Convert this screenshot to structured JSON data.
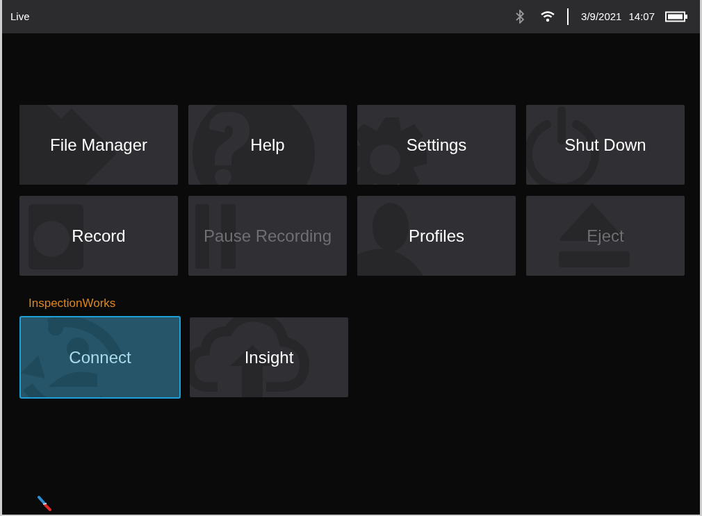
{
  "status_bar": {
    "mode": "Live",
    "date": "3/9/2021",
    "time": "14:07"
  },
  "tiles": [
    {
      "label": "File Manager",
      "kind": "folder",
      "disabled": false,
      "selected": false
    },
    {
      "label": "Help",
      "kind": "help",
      "disabled": false,
      "selected": false
    },
    {
      "label": "Settings",
      "kind": "gear",
      "disabled": false,
      "selected": false
    },
    {
      "label": "Shut Down",
      "kind": "power",
      "disabled": false,
      "selected": false
    },
    {
      "label": "Record",
      "kind": "record",
      "disabled": false,
      "selected": false
    },
    {
      "label": "Pause Recording",
      "kind": "pause",
      "disabled": true,
      "selected": false
    },
    {
      "label": "Profiles",
      "kind": "person",
      "disabled": false,
      "selected": false
    },
    {
      "label": "Eject",
      "kind": "eject",
      "disabled": true,
      "selected": false
    }
  ],
  "section": {
    "title": "InspectionWorks",
    "tiles": [
      {
        "label": "Connect",
        "kind": "sync",
        "disabled": false,
        "selected": true
      },
      {
        "label": "Insight",
        "kind": "cloud",
        "disabled": false,
        "selected": false
      }
    ]
  }
}
